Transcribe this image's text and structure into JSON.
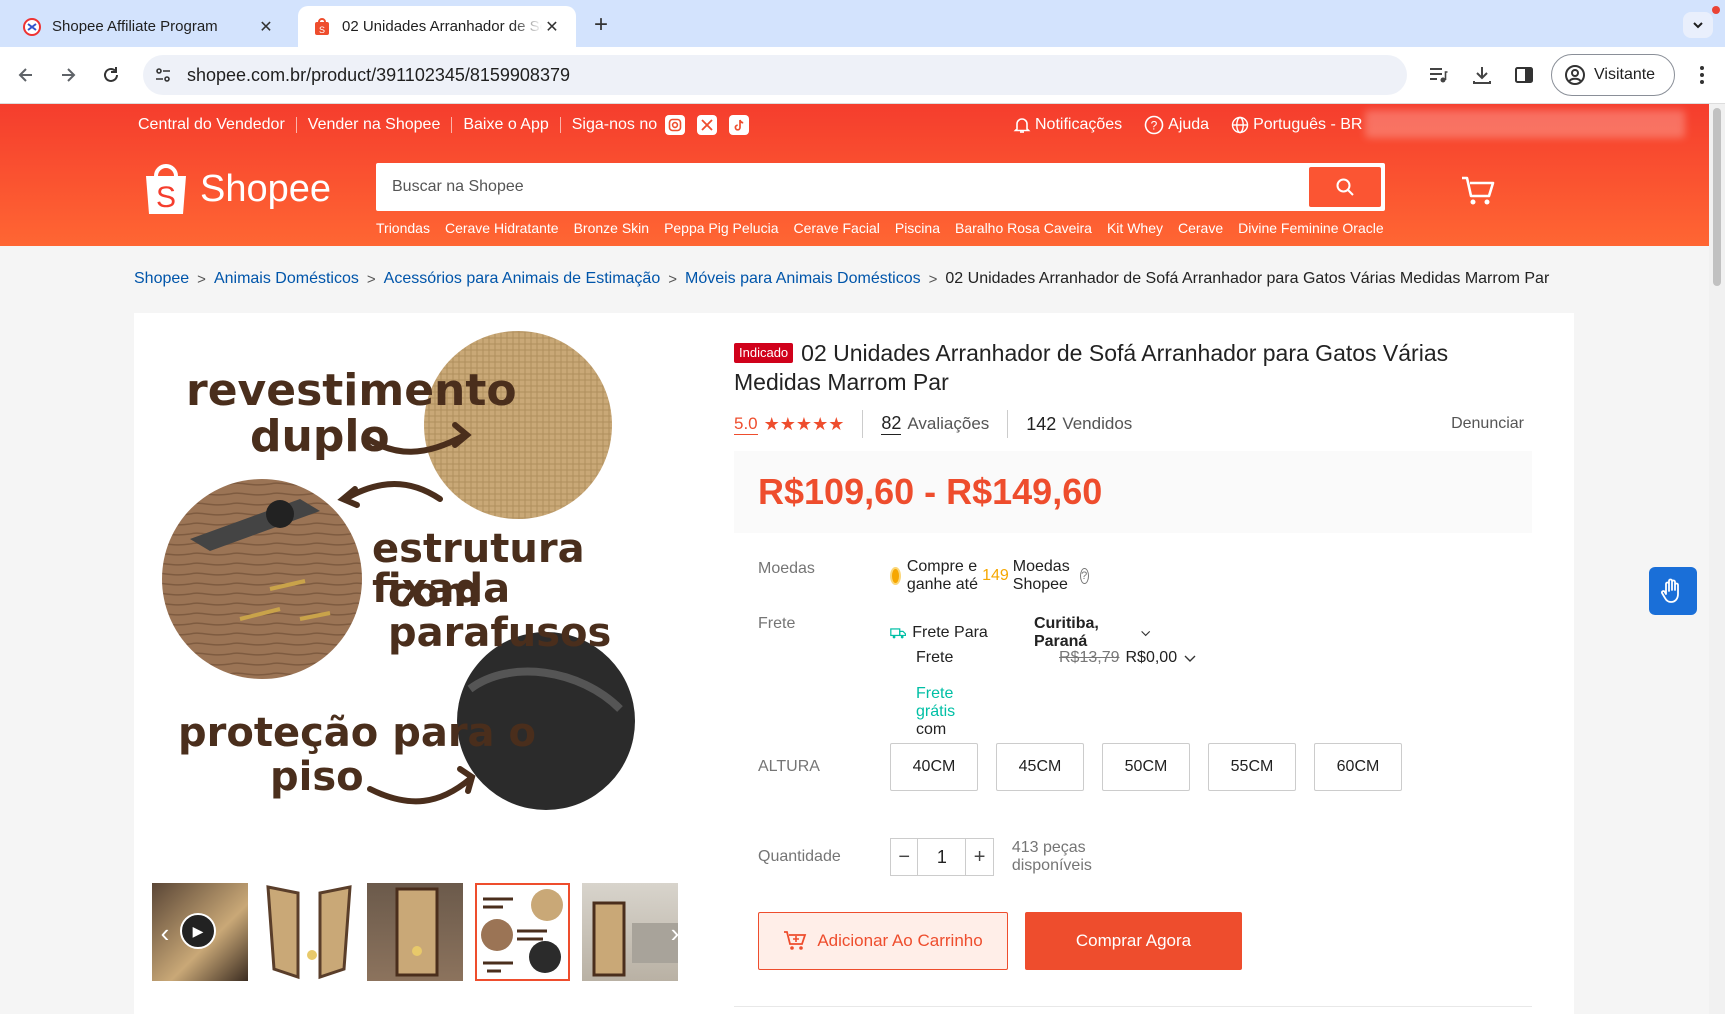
{
  "browser": {
    "tabs": [
      {
        "title": "Shopee Affiliate Program"
      },
      {
        "title": "02 Unidades Arranhador de Sofá Arranhador para Gatos Várias Medidas Marrom Par"
      }
    ],
    "url": "shopee.com.br/product/391102345/8159908379",
    "profile_label": "Visitante"
  },
  "header": {
    "top_links": [
      "Central do Vendedor",
      "Vender na Shopee",
      "Baixe o App",
      "Siga-nos no"
    ],
    "notifications": "Notificações",
    "help": "Ajuda",
    "language": "Português - BR",
    "logo_text": "Shopee",
    "search_placeholder": "Buscar na Shopee",
    "suggestions": [
      "Triondas",
      "Cerave Hidratante",
      "Bronze Skin",
      "Peppa Pig Pelucia",
      "Cerave Facial",
      "Piscina",
      "Baralho Rosa Caveira",
      "Kit Whey",
      "Cerave",
      "Divine Feminine Oracle"
    ]
  },
  "breadcrumb": [
    "Shopee",
    "Animais Domésticos",
    "Acessórios para Animais de Estimação",
    "Móveis para Animais Domésticos",
    "02 Unidades Arranhador de Sofá Arranhador para Gatos Várias Medidas Marrom Par"
  ],
  "image": {
    "text1": "revestimento",
    "text2": "duplo",
    "text3": "estrutura fixada",
    "text4": "com parafusos",
    "text5": "proteção para o",
    "text6": "piso"
  },
  "product": {
    "badge": "Indicado",
    "title": "02 Unidades Arranhador de Sofá Arranhador para Gatos Várias Medidas Marrom Par",
    "rating": "5.0",
    "rating_fraction": 1.0,
    "reviews_count": "82",
    "reviews_label": "Avaliações",
    "sold_count": "142",
    "sold_label": "Vendidos",
    "report": "Denunciar",
    "price": "R$109,60 - R$149,60",
    "coins_label": "Moedas",
    "coins_text_before": "Compre e ganhe até",
    "coins_amount": "149",
    "coins_text_after": "Moedas Shopee",
    "shipping_label": "Frete",
    "ship_to_label": "Frete Para",
    "ship_to_city": "Curitiba, Paraná",
    "fee_label": "Frete",
    "fee_old": "R$13,79",
    "fee_new": "R$0,00",
    "free_ship": "Frete grátis",
    "free_ship_suffix": "com cupom",
    "size_label": "ALTURA",
    "sizes": [
      "40CM",
      "45CM",
      "50CM",
      "55CM",
      "60CM"
    ],
    "qty_label": "Quantidade",
    "qty": "1",
    "stock": "413 peças disponíveis",
    "add_to_cart": "Adicionar Ao Carrinho",
    "buy_now": "Comprar Agora"
  },
  "colors": {
    "brand": "#ee4d2d",
    "header": "#f53d2d",
    "link": "#0055aa",
    "free_ship": "#00bfa5"
  }
}
